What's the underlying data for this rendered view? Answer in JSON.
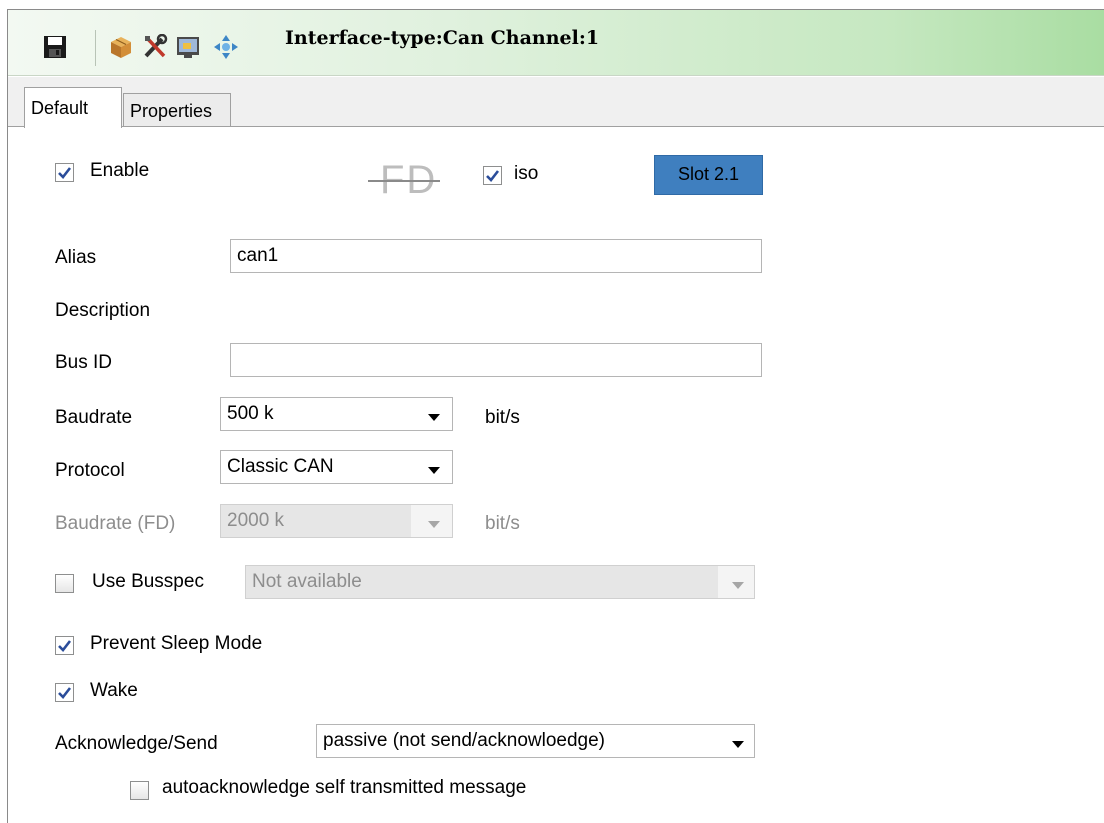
{
  "window": {
    "title": "Interface-type:Can Channel:1",
    "toolbar_icons": [
      "save-icon",
      "package-icon",
      "tools-icon",
      "monitor-icon",
      "move-icon"
    ]
  },
  "tabs": [
    {
      "label": "Default",
      "active": true
    },
    {
      "label": "Properties",
      "active": false
    }
  ],
  "form": {
    "enable": {
      "label": "Enable",
      "checked": true
    },
    "fd_logo": "FD",
    "iso": {
      "label": "iso",
      "checked": true
    },
    "slot_button": "Slot 2.1",
    "alias": {
      "label": "Alias",
      "value": "can1"
    },
    "description": {
      "label": "Description"
    },
    "bus_id": {
      "label": "Bus ID",
      "value": ""
    },
    "baudrate": {
      "label": "Baudrate",
      "value": "500 k",
      "unit": "bit/s"
    },
    "protocol": {
      "label": "Protocol",
      "value": "Classic CAN"
    },
    "baudrate_fd": {
      "label": "Baudrate (FD)",
      "value": "2000 k",
      "unit": "bit/s",
      "disabled": true
    },
    "use_busspec": {
      "label": "Use Busspec",
      "checked": false,
      "value": "Not available"
    },
    "prevent_sleep": {
      "label": "Prevent Sleep Mode",
      "checked": true
    },
    "wake": {
      "label": "Wake",
      "checked": true
    },
    "ack_send": {
      "label": "Acknowledge/Send",
      "value": "passive (not send/acknowloedge)"
    },
    "autoack": {
      "label": "autoacknowledge self transmitted message",
      "checked": false
    }
  },
  "colors": {
    "slot_button_bg": "#3f7fbf",
    "title_gradient_end": "#a9dda2"
  }
}
